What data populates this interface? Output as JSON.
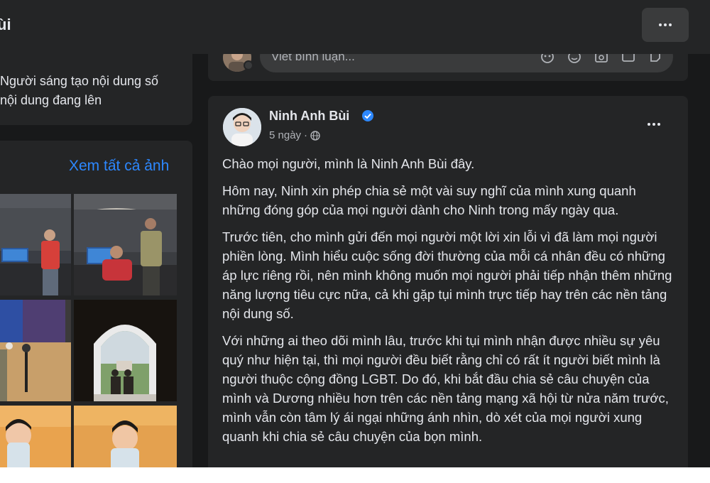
{
  "header": {
    "title": "ùi",
    "more_icon": "more-horizontal-icon"
  },
  "intro": {
    "lines": [
      "Người sáng tạo nội dung số",
      "nội dung đang lên"
    ]
  },
  "photos": {
    "see_all_label": "Xem tất cả ảnh"
  },
  "comment_box": {
    "placeholder": "Viết bình luận...",
    "icons": [
      "avatar-sticker-icon",
      "emoji-icon",
      "camera-icon",
      "gif-icon",
      "sticker-icon"
    ]
  },
  "post": {
    "author": "Ninh Anh Bùi",
    "time": "5 ngày",
    "separator": "·",
    "paragraphs": [
      "Chào mọi người, mình là Ninh Anh Bùi đây.",
      "Hôm nay, Ninh xin phép chia sẻ một vài suy nghĩ của mình xung quanh những đóng góp của mọi người dành cho Ninh trong mấy ngày qua.",
      "Trước tiên, cho mình gửi đến mọi người một lời xin lỗi vì đã làm mọi người phiền lòng. Mình hiểu cuộc sống đời thường của mỗi cá nhân đều có những áp lực riêng rồi, nên mình không muốn mọi người phải tiếp nhận thêm những năng lượng tiêu cực nữa, cả khi gặp tụi mình trực tiếp hay trên các nền tảng nội dung số.",
      "Với những ai theo dõi mình lâu, trước khi tụi mình nhận được nhiều sự yêu quý như hiện tại, thì mọi người đều biết rằng chỉ có rất ít người biết mình là người thuộc cộng đồng LGBT. Do đó, khi bắt đầu chia sẻ câu chuyện của mình và Dương nhiều hơn trên các nền tảng mạng xã hội từ nửa năm trước, mình vẫn còn tâm lý ái ngại những ánh nhìn, dò xét của mọi người xung quanh khi chia sẻ câu chuyện của bọn mình."
    ]
  },
  "colors": {
    "bg": "#18191a",
    "card": "#242526",
    "input": "#3a3b3c",
    "text": "#e4e6eb",
    "muted": "#b0b3b8",
    "link": "#2d88ff",
    "verified": "#2d88ff"
  }
}
